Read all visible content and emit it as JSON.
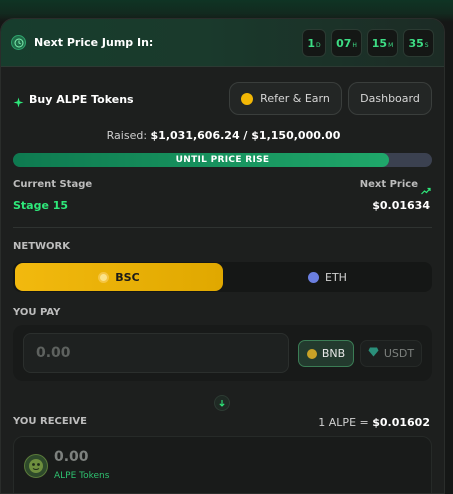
{
  "header": {
    "title": "Next Price Jump In:",
    "timer": [
      {
        "value": "1",
        "unit": "D"
      },
      {
        "value": "07",
        "unit": "H"
      },
      {
        "value": "15",
        "unit": "M"
      },
      {
        "value": "35",
        "unit": "S"
      }
    ]
  },
  "buy": {
    "title": "Buy ALPE Tokens",
    "refer_label": "Refer & Earn",
    "dashboard_label": "Dashboard"
  },
  "raised": {
    "prefix": "Raised:",
    "amount": "$1,031,606.24 / $1,150,000.00",
    "progress_label": "UNTIL PRICE RISE",
    "progress_fraction": 0.897
  },
  "stage": {
    "current_label": "Current Stage",
    "current_value": "Stage 15",
    "next_label": "Next Price",
    "next_value": "$0.01634"
  },
  "network": {
    "label": "NETWORK",
    "options": [
      {
        "label": "BSC",
        "selected": true
      },
      {
        "label": "ETH",
        "selected": false
      }
    ]
  },
  "pay": {
    "label": "YOU PAY",
    "placeholder": "0.00",
    "currencies": [
      {
        "label": "BNB",
        "selected": true
      },
      {
        "label": "USDT",
        "selected": false
      }
    ]
  },
  "receive": {
    "label": "YOU RECEIVE",
    "rate_prefix": "1 ALPE =",
    "rate_value": "$0.01602",
    "amount": "0.00",
    "unit": "ALPE Tokens"
  },
  "colors": {
    "accent_green": "#2ee87a",
    "accent_yellow": "#f2b90e",
    "background": "#1d1f1e"
  }
}
